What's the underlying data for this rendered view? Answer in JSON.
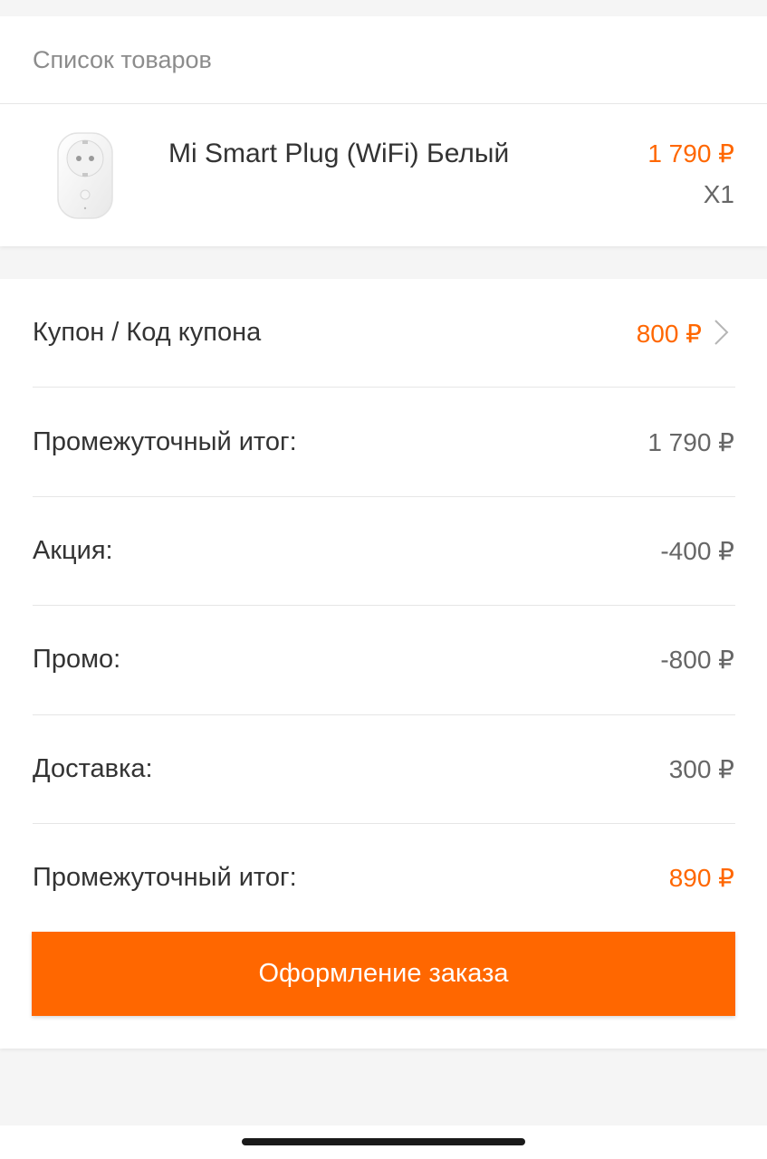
{
  "product_list": {
    "title": "Список товаров",
    "items": [
      {
        "name": "Mi Smart Plug (WiFi) Белый",
        "price": "1 790 ₽",
        "quantity": "X1",
        "image_icon": "smart-plug-icon"
      }
    ]
  },
  "coupon": {
    "label": "Купон / Код купона",
    "value": "800 ₽",
    "icon": "chevron-right-icon"
  },
  "summary": {
    "rows": [
      {
        "label": "Промежуточный итог:",
        "value": "1 790 ₽"
      },
      {
        "label": "Акция:",
        "value": "-400 ₽"
      },
      {
        "label": "Промо:",
        "value": "-800 ₽"
      },
      {
        "label": "Доставка:",
        "value": "300 ₽"
      }
    ],
    "total": {
      "label": "Промежуточный итог:",
      "value": "890 ₽"
    }
  },
  "checkout_button": {
    "label": "Оформление заказа"
  },
  "colors": {
    "accent": "#ff6700",
    "text_primary": "#333333",
    "text_secondary": "#666666",
    "text_muted": "#8c8c8c",
    "divider": "#e6e6e6",
    "background": "#f5f5f5"
  }
}
